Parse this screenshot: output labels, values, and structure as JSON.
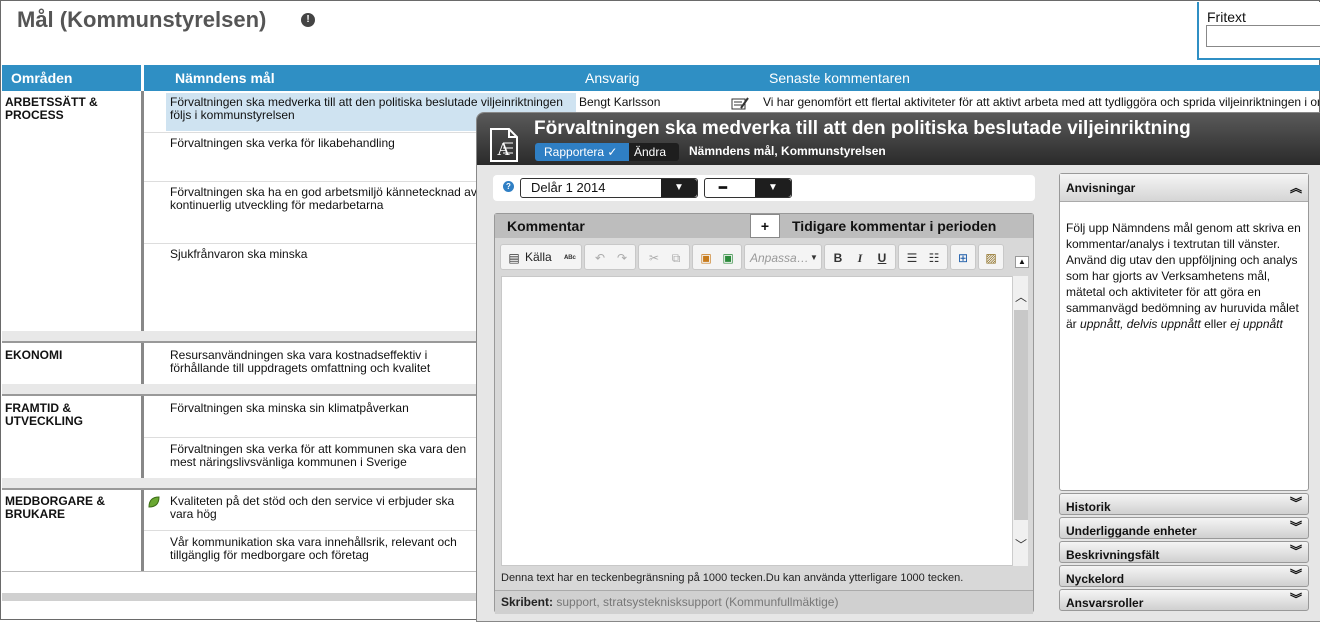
{
  "page": {
    "title": "Mål (Kommunstyrelsen)",
    "info_icon": "!",
    "fritext_label": "Fritext"
  },
  "table": {
    "headers": {
      "omraden": "Områden",
      "mal": "Nämndens mål",
      "ansvarig": "Ansvarig",
      "senaste": "Senaste kommentaren"
    },
    "areas": [
      {
        "name": "ARBETSSÄTT & PROCESS"
      },
      {
        "name": "EKONOMI"
      },
      {
        "name": "FRAMTID & UTVECKLING"
      },
      {
        "name": "MEDBORGARE & BRUKARE"
      }
    ],
    "goals": [
      "Förvaltningen ska medverka till att den politiska beslutade viljeinriktningen följs i kommunstyrelsen",
      "Förvaltningen ska verka för likabehandling",
      "Förvaltningen ska ha en god arbetsmiljö kännetecknad av kontinuerlig utveckling för medarbetarna",
      "Sjukfrånvaron ska minska",
      "Resursanvändningen ska vara kostnadseffektiv i förhållande till uppdragets omfattning och kvalitet",
      "Förvaltningen ska minska sin klimatpåverkan",
      "Förvaltningen ska verka för att kommunen ska vara den mest näringslivsvänliga kommunen i Sverige",
      "Kvaliteten på det stöd och den service vi erbjuder ska vara hög",
      "Vår kommunikation ska vara innehållsrik, relevant och tillgänglig för medborgare och företag"
    ],
    "first_row": {
      "ansvarig": "Bengt Karlsson",
      "senaste": "Vi har genomfört ett flertal aktiviteter för att aktivt arbeta med att tydliggöra och sprida viljeinriktningen i organisationen"
    }
  },
  "dialog": {
    "title": "Förvaltningen ska medverka till att den politiska beslutade viljeinriktning",
    "tab_rapportera": "Rapportera ✓",
    "tab_andra": "Ändra",
    "subtitle": "Nämndens mål, Kommunstyrelsen",
    "period": "Delår 1 2014",
    "status": "━",
    "help": "?",
    "tab_kommentar": "Kommentar",
    "tab_plus": "+",
    "tab_tidigare": "Tidigare kommentar i perioden",
    "toolbar": {
      "kalla": "Källa",
      "anpassa": "Anpassa…",
      "bold": "B",
      "italic": "I",
      "underline": "U"
    },
    "charlimit": "Denna text har en teckenbegränsning på 1000 tecken.Du kan använda ytterligare 1000 tecken.",
    "skribent_label": "Skribent:",
    "skribent_value": "support, stratsystekni­sksupport (Kommunfullmäktige)",
    "anvisningar": {
      "title": "Anvisningar",
      "body_1": "Följ upp Nämndens mål genom att skriva en kommentar/analys i textrutan till vänster. Använd dig utav den uppföljning och analys som har gjorts av Verksamhetens mål, mätetal och aktiviteter för att göra en sammanvägd bedömning av huruvida målet är ",
      "body_em1": "uppnått",
      "body_2": ", ",
      "body_em2": "delvis uppnått",
      "body_3": " eller ",
      "body_em3": "ej uppnått"
    },
    "accordion": [
      "Historik",
      "Underliggande enheter",
      "Beskrivningsfält",
      "Nyckelord",
      "Ansvarsroller"
    ]
  }
}
